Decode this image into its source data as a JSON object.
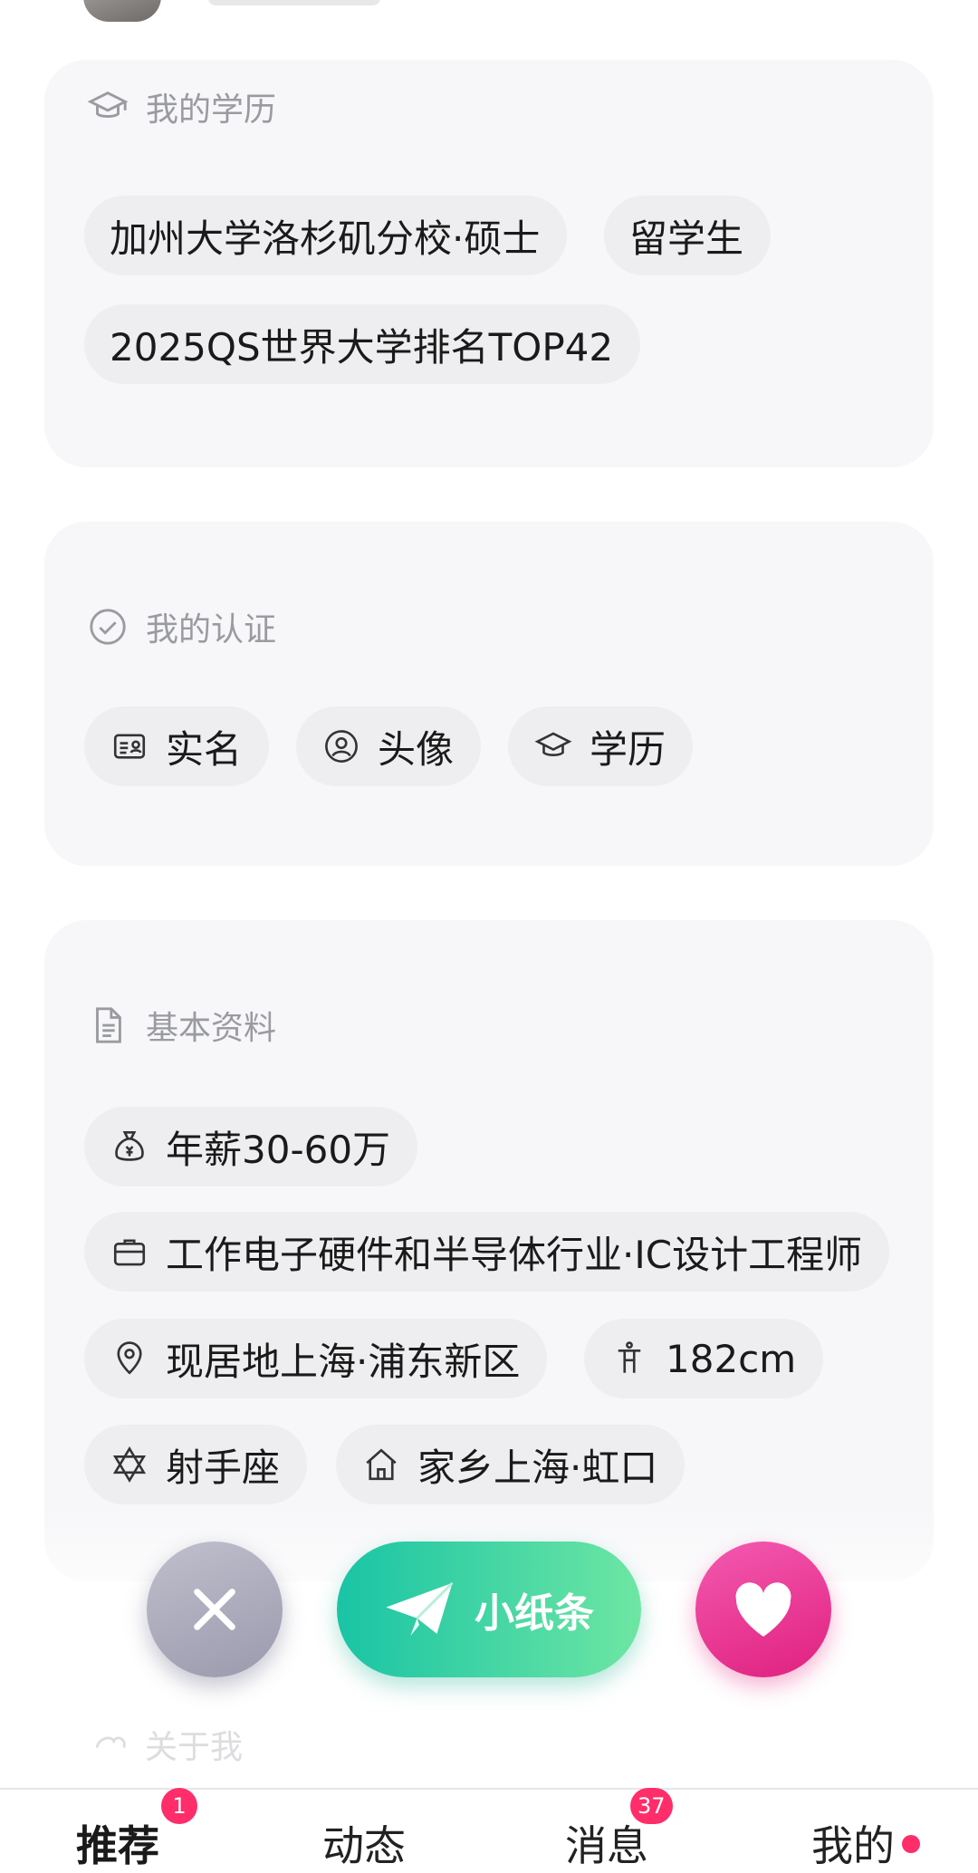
{
  "education": {
    "title": "我的学历",
    "tags": [
      "加州大学洛杉矶分校·硕士",
      "留学生",
      "2025QS世界大学排名TOP42"
    ]
  },
  "verification": {
    "title": "我的认证",
    "tags": [
      {
        "label": "实名",
        "icon": "id-card-icon"
      },
      {
        "label": "头像",
        "icon": "avatar-icon"
      },
      {
        "label": "学历",
        "icon": "graduation-cap-icon"
      }
    ]
  },
  "basic_info": {
    "title": "基本资料",
    "tags": [
      {
        "label": "年薪30-60万",
        "icon": "money-bag-icon"
      },
      {
        "label": "工作电子硬件和半导体行业·IC设计工程师",
        "icon": "briefcase-icon"
      },
      {
        "label": "现居地上海·浦东新区",
        "icon": "location-pin-icon"
      },
      {
        "label": "182cm",
        "icon": "height-icon"
      },
      {
        "label": "射手座",
        "icon": "star-of-david-icon"
      },
      {
        "label": "家乡上海·虹口",
        "icon": "home-icon"
      }
    ]
  },
  "actions": {
    "note_label": "小纸条"
  },
  "about": {
    "title": "关于我"
  },
  "tabbar": {
    "tabs": [
      {
        "label": "推荐",
        "badge": "1"
      },
      {
        "label": "动态"
      },
      {
        "label": "消息",
        "badge": "37"
      },
      {
        "label": "我的",
        "dot": true
      }
    ]
  },
  "colors": {
    "card_bg": "#f7f7f9",
    "tag_bg": "#eeeef0",
    "accent_teal": "#19c4a5",
    "accent_pink": "#e0207f",
    "badge": "#ff2d6a"
  }
}
